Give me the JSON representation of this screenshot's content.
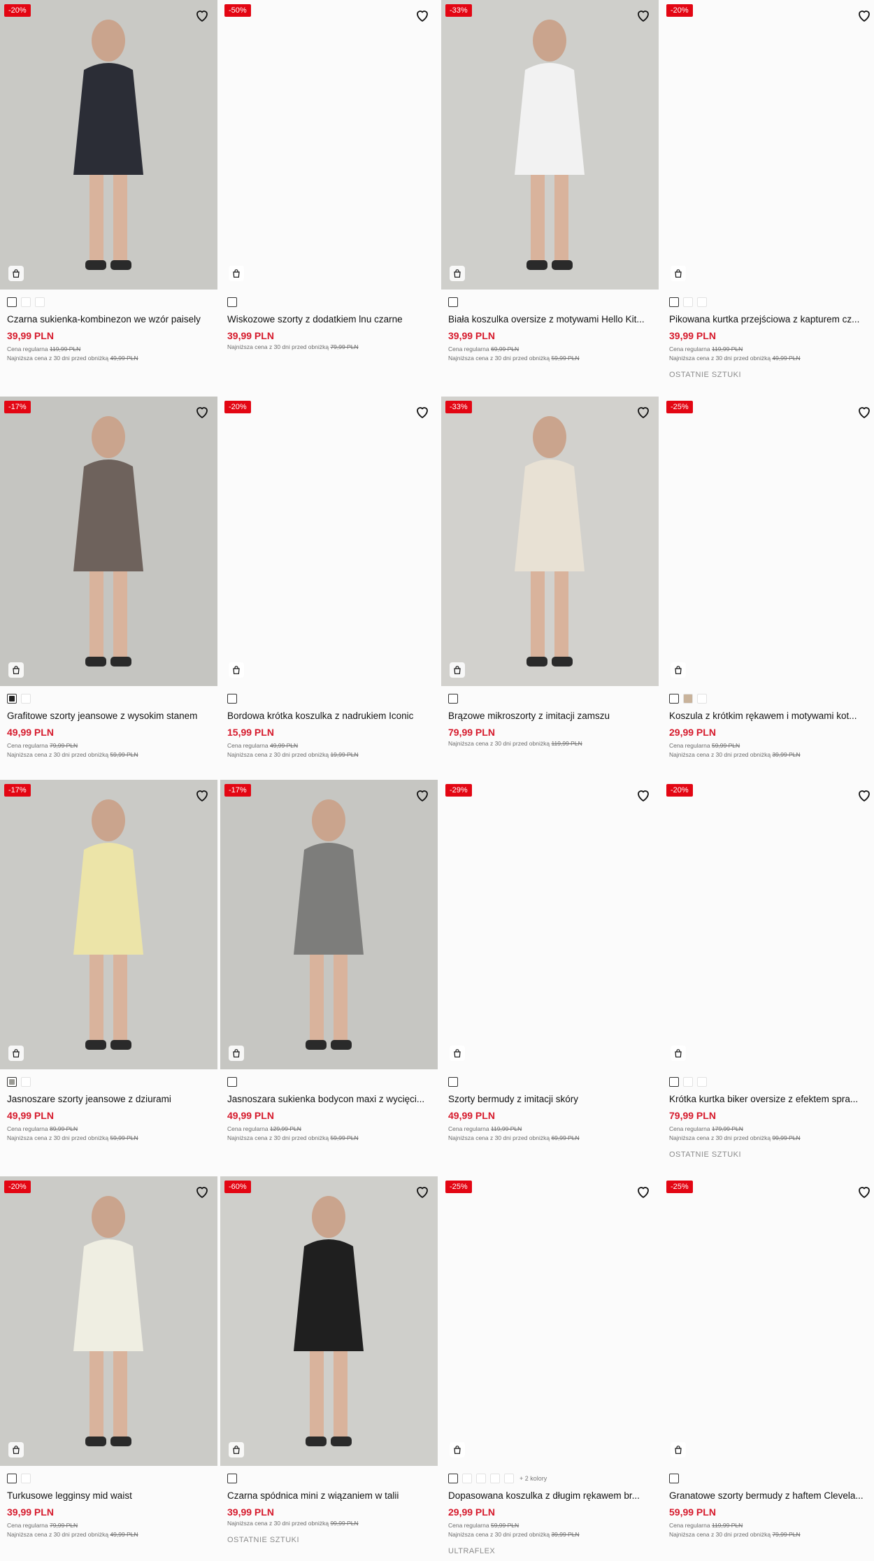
{
  "labels": {
    "regular_prefix": "Cena regularna",
    "lowest_prefix": "Najniższa cena z 30 dni przed obniżką"
  },
  "products": [
    {
      "badge": "-20%",
      "title": "Czarna sukienka-kombinezon we wzór paisely",
      "price": "39,99 PLN",
      "regular": "119,99 PLN",
      "lowest": "49,99 PLN",
      "note": "",
      "swatches": 3,
      "more": ""
    },
    {
      "badge": "-50%",
      "title": "Wiskozowe szorty z dodatkiem lnu czarne",
      "price": "39,99 PLN",
      "regular": "",
      "lowest": "79,99 PLN",
      "note": "",
      "swatches": 1,
      "more": ""
    },
    {
      "badge": "-33%",
      "title": "Biała koszulka oversize z motywami Hello Kit...",
      "price": "39,99 PLN",
      "regular": "69,99 PLN",
      "lowest": "59,99 PLN",
      "note": "",
      "swatches": 1,
      "more": ""
    },
    {
      "badge": "-20%",
      "title": "Pikowana kurtka przejściowa z kapturem cz...",
      "price": "39,99 PLN",
      "regular": "119,99 PLN",
      "lowest": "49,99 PLN",
      "note": "OSTATNIE SZTUKI",
      "swatches": 3,
      "more": ""
    },
    {
      "badge": "-17%",
      "title": "Grafitowe szorty jeansowe z wysokim stanem",
      "price": "49,99 PLN",
      "regular": "79,99 PLN",
      "lowest": "59,99 PLN",
      "note": "",
      "swatches": 2,
      "more": ""
    },
    {
      "badge": "-20%",
      "title": "Bordowa krótka koszulka z nadrukiem Iconic",
      "price": "15,99 PLN",
      "regular": "49,99 PLN",
      "lowest": "19,99 PLN",
      "note": "",
      "swatches": 1,
      "more": ""
    },
    {
      "badge": "-33%",
      "title": "Brązowe mikroszorty z imitacji zamszu",
      "price": "79,99 PLN",
      "regular": "",
      "lowest": "119,99 PLN",
      "note": "",
      "swatches": 1,
      "more": ""
    },
    {
      "badge": "-25%",
      "title": "Koszula z krótkim rękawem i motywami kot...",
      "price": "29,99 PLN",
      "regular": "59,99 PLN",
      "lowest": "39,99 PLN",
      "note": "",
      "swatches": 3,
      "more": ""
    },
    {
      "badge": "-17%",
      "title": "Jasnoszare szorty jeansowe z dziurami",
      "price": "49,99 PLN",
      "regular": "89,99 PLN",
      "lowest": "59,99 PLN",
      "note": "",
      "swatches": 2,
      "more": ""
    },
    {
      "badge": "-17%",
      "title": "Jasnoszara sukienka bodycon maxi z wycięci...",
      "price": "49,99 PLN",
      "regular": "129,99 PLN",
      "lowest": "59,99 PLN",
      "note": "",
      "swatches": 1,
      "more": ""
    },
    {
      "badge": "-29%",
      "title": "Szorty bermudy z imitacji skóry",
      "price": "49,99 PLN",
      "regular": "119,99 PLN",
      "lowest": "69,99 PLN",
      "note": "",
      "swatches": 1,
      "more": ""
    },
    {
      "badge": "-20%",
      "title": "Krótka kurtka biker oversize z efektem spra...",
      "price": "79,99 PLN",
      "regular": "179,99 PLN",
      "lowest": "99,99 PLN",
      "note": "OSTATNIE SZTUKI",
      "swatches": 3,
      "more": ""
    },
    {
      "badge": "-20%",
      "title": "Turkusowe legginsy mid waist",
      "price": "39,99 PLN",
      "regular": "79,99 PLN",
      "lowest": "49,99 PLN",
      "note": "",
      "swatches": 2,
      "more": ""
    },
    {
      "badge": "-60%",
      "title": "Czarna spódnica mini z wiązaniem w talii",
      "price": "39,99 PLN",
      "regular": "",
      "lowest": "99,99 PLN",
      "note": "OSTATNIE SZTUKI",
      "swatches": 1,
      "more": ""
    },
    {
      "badge": "-25%",
      "title": "Dopasowana koszulka z długim rękawem br...",
      "price": "29,99 PLN",
      "regular": "59,99 PLN",
      "lowest": "39,99 PLN",
      "note": "ULTRAFLEX",
      "swatches": 5,
      "more": "+ 2 kolory"
    },
    {
      "badge": "-25%",
      "title": "Granatowe szorty bermudy z haftem Clevela...",
      "price": "59,99 PLN",
      "regular": "119,99 PLN",
      "lowest": "79,99 PLN",
      "note": "",
      "swatches": 1,
      "more": ""
    }
  ],
  "colors": {
    "sale_red": "#e30613",
    "price_red": "#d61a2c"
  }
}
